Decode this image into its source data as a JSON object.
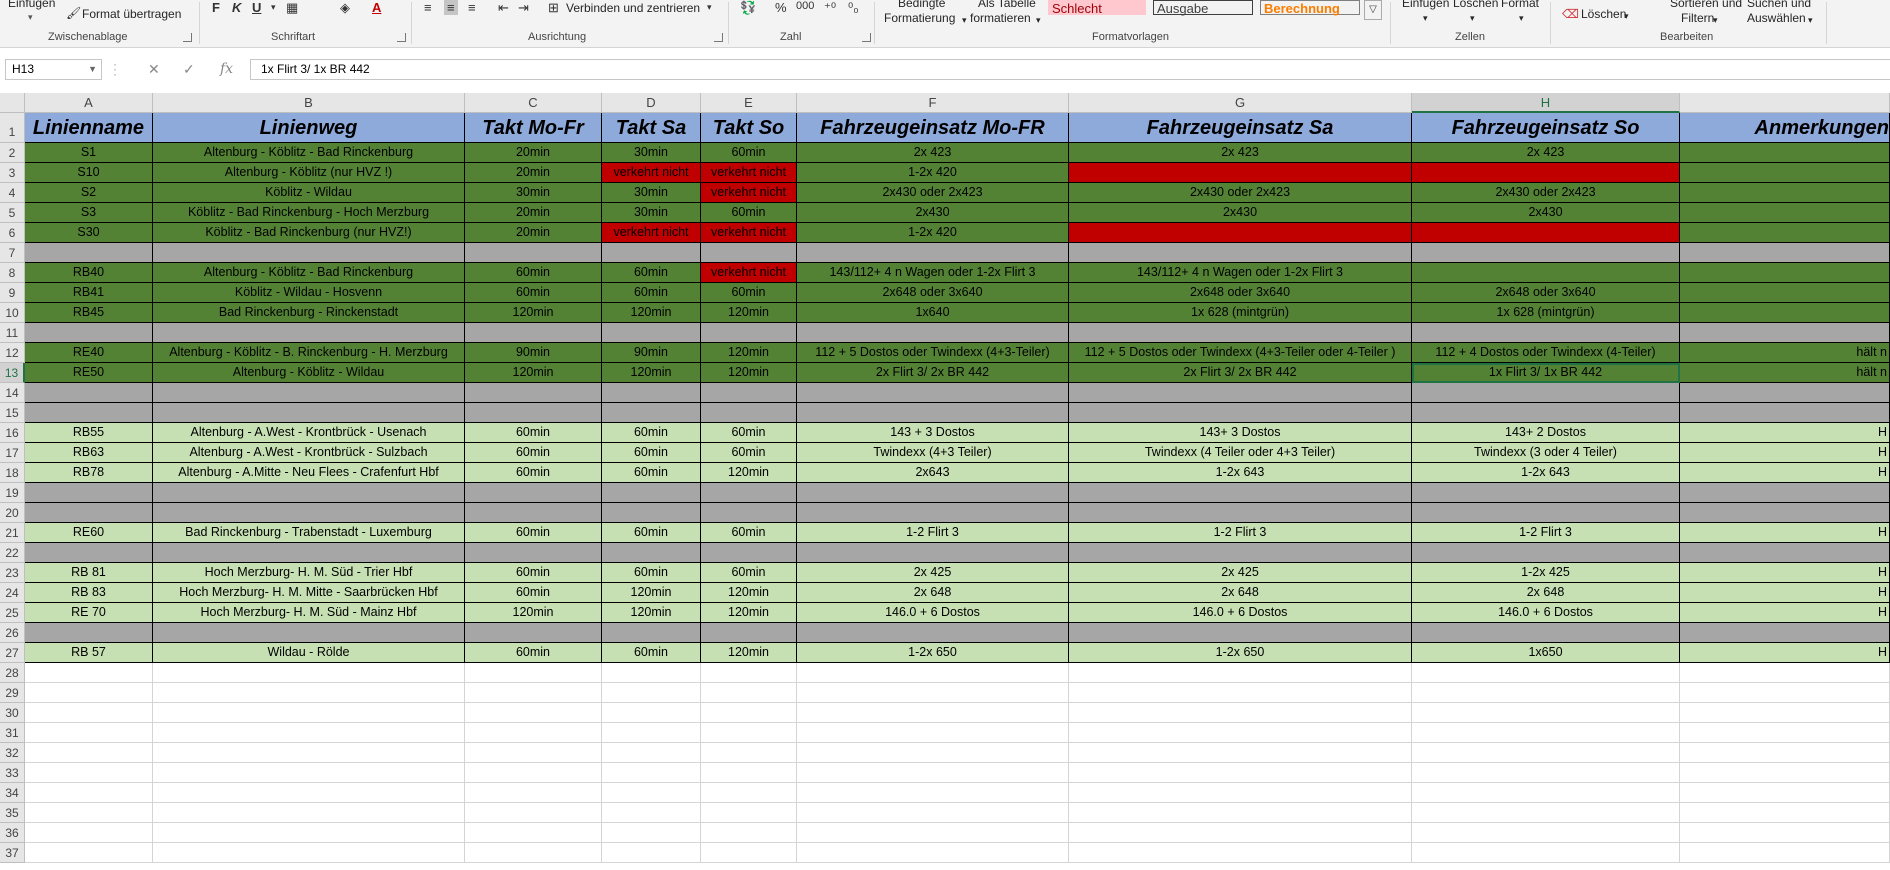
{
  "ribbon": {
    "einfuegen": "Einfügen",
    "format_uebertragen": "Format übertragen",
    "group_zwischenablage": "Zwischenablage",
    "font_buttons": [
      "F",
      "K",
      "U"
    ],
    "group_schriftart": "Schriftart",
    "verbinden": "Verbinden und zentrieren",
    "group_ausrichtung": "Ausrichtung",
    "zahl_percent": "%",
    "zahl_thousands": "000",
    "group_zahl": "Zahl",
    "bedingte_1": "Bedingte",
    "bedingte_2": "Formatierung",
    "tabelle_1": "Als Tabelle",
    "tabelle_2": "formatieren",
    "style_schlecht": "Schlecht",
    "style_ausgabe": "Ausgabe",
    "style_berechnung": "Berechnung",
    "group_formatvorlagen": "Formatvorlagen",
    "zellen_einfuegen": "Einfügen",
    "zellen_loeschen": "Löschen",
    "zellen_format": "Format",
    "group_zellen": "Zellen",
    "loeschen": "Löschen",
    "sortieren_1": "Sortieren und",
    "sortieren_2": "Filtern",
    "suchen_1": "Suchen und",
    "suchen_2": "Auswählen",
    "group_bearbeiten": "Bearbeiten"
  },
  "formula_bar": {
    "name_box": "H13",
    "formula": "1x Flirt 3/ 1x BR 442"
  },
  "columns": [
    "A",
    "B",
    "C",
    "D",
    "E",
    "F",
    "G",
    "H",
    ""
  ],
  "rows": [
    {
      "n": "1",
      "t": "hdr",
      "c": [
        "Linienname",
        "Linienweg",
        "Takt Mo-Fr",
        "Takt Sa",
        "Takt So",
        "Fahrzeugeinsatz Mo-FR",
        "Fahrzeugeinsatz Sa",
        "Fahrzeugeinsatz So",
        "Anmerkungen"
      ]
    },
    {
      "n": "2",
      "t": "dk",
      "c": [
        "S1",
        "Altenburg - Köblitz - Bad Rinckenburg",
        "20min",
        "30min",
        "60min",
        "2x 423",
        "2x 423",
        "2x 423",
        ""
      ]
    },
    {
      "n": "3",
      "t": "dk",
      "c": [
        "S10",
        "Altenburg - Köblitz (nur HVZ !)",
        "20min",
        "verkehrt nicht",
        "verkehrt nicht",
        "1-2x 420",
        "",
        "",
        ""
      ],
      "red": [
        3,
        4,
        6,
        7
      ]
    },
    {
      "n": "4",
      "t": "dk",
      "c": [
        "S2",
        "Köblitz - Wildau",
        "30min",
        "30min",
        "verkehrt nicht",
        "2x430 oder 2x423",
        "2x430 oder 2x423",
        "2x430 oder 2x423",
        ""
      ],
      "red": [
        4
      ]
    },
    {
      "n": "5",
      "t": "dk",
      "c": [
        "S3",
        "Köblitz  - Bad Rinckenburg - Hoch Merzburg",
        "20min",
        "30min",
        "60min",
        "2x430",
        "2x430",
        "2x430",
        ""
      ]
    },
    {
      "n": "6",
      "t": "dk",
      "c": [
        "S30",
        "Köblitz - Bad Rinckenburg (nur HVZ!)",
        "20min",
        "verkehrt nicht",
        "verkehrt nicht",
        "1-2x 420",
        "",
        "",
        ""
      ],
      "red": [
        3,
        4,
        6,
        7
      ]
    },
    {
      "n": "7",
      "t": "gr",
      "c": [
        "",
        "",
        "",
        "",
        "",
        "",
        "",
        "",
        ""
      ]
    },
    {
      "n": "8",
      "t": "dk",
      "c": [
        "RB40",
        "Altenburg - Köblitz - Bad Rinckenburg",
        "60min",
        "60min",
        "verkehrt nicht",
        "143/112+ 4 n Wagen oder 1-2x Flirt 3",
        "143/112+ 4 n Wagen oder 1-2x Flirt 3",
        "",
        ""
      ],
      "red": [
        4
      ]
    },
    {
      "n": "9",
      "t": "dk",
      "c": [
        "RB41",
        "Köblitz - Wildau - Hosvenn",
        "60min",
        "60min",
        "60min",
        "2x648 oder 3x640",
        "2x648 oder 3x640",
        "2x648 oder 3x640",
        ""
      ]
    },
    {
      "n": "10",
      "t": "dk",
      "c": [
        "RB45",
        "Bad Rinckenburg - Rinckenstadt",
        "120min",
        "120min",
        "120min",
        "1x640",
        "1x 628 (mintgrün)",
        "1x 628 (mintgrün)",
        ""
      ]
    },
    {
      "n": "11",
      "t": "gr",
      "c": [
        "",
        "",
        "",
        "",
        "",
        "",
        "",
        "",
        ""
      ]
    },
    {
      "n": "12",
      "t": "dk",
      "c": [
        "RE40",
        "Altenburg - Köblitz - B. Rinckenburg - H. Merzburg",
        "90min",
        "90min",
        "120min",
        "112 + 5 Dostos oder Twindexx (4+3-Teiler)",
        "112 + 5 Dostos oder Twindexx (4+3-Teiler oder 4-Teiler )",
        "112 + 4 Dostos oder Twindexx (4-Teiler)",
        "hält n"
      ]
    },
    {
      "n": "13",
      "t": "dk",
      "c": [
        "RE50",
        "Altenburg - Köblitz - Wildau",
        "120min",
        "120min",
        "120min",
        "2x Flirt 3/ 2x BR 442",
        "2x Flirt 3/ 2x BR 442",
        "1x Flirt 3/ 1x BR 442",
        "hält n"
      ]
    },
    {
      "n": "14",
      "t": "gr",
      "c": [
        "",
        "",
        "",
        "",
        "",
        "",
        "",
        "",
        ""
      ]
    },
    {
      "n": "15",
      "t": "gr",
      "c": [
        "",
        "",
        "",
        "",
        "",
        "",
        "",
        "",
        ""
      ]
    },
    {
      "n": "16",
      "t": "lt",
      "c": [
        "RB55",
        "Altenburg - A.West - Krontbrück - Usenach",
        "60min",
        "60min",
        "60min",
        "143 + 3 Dostos",
        "143+ 3 Dostos",
        "143+ 2 Dostos",
        "H"
      ]
    },
    {
      "n": "17",
      "t": "lt",
      "c": [
        "RB63",
        "Altenburg - A.West - Krontbrück - Sulzbach",
        "60min",
        "60min",
        "60min",
        "Twindexx (4+3 Teiler)",
        "Twindexx (4 Teiler oder 4+3 Teiler)",
        "Twindexx (3 oder 4 Teiler)",
        "H"
      ]
    },
    {
      "n": "18",
      "t": "lt",
      "c": [
        "RB78",
        "Altenburg - A.Mitte - Neu Flees - Crafenfurt Hbf",
        "60min",
        "60min",
        "120min",
        "2x643",
        "1-2x 643",
        "1-2x 643",
        "H"
      ]
    },
    {
      "n": "19",
      "t": "gr",
      "c": [
        "",
        "",
        "",
        "",
        "",
        "",
        "",
        "",
        ""
      ]
    },
    {
      "n": "20",
      "t": "gr",
      "c": [
        "",
        "",
        "",
        "",
        "",
        "",
        "",
        "",
        ""
      ]
    },
    {
      "n": "21",
      "t": "lt",
      "c": [
        "RE60",
        "Bad Rinckenburg - Trabenstadt - Luxemburg",
        "60min",
        "60min",
        "60min",
        "1-2 Flirt 3",
        "1-2 Flirt 3",
        "1-2 Flirt 3",
        "H"
      ]
    },
    {
      "n": "22",
      "t": "gr",
      "c": [
        "",
        "",
        "",
        "",
        "",
        "",
        "",
        "",
        ""
      ]
    },
    {
      "n": "23",
      "t": "lt",
      "c": [
        "RB 81",
        "Hoch Merzburg- H. M. Süd - Trier  Hbf",
        "60min",
        "60min",
        "60min",
        "2x 425",
        "2x 425",
        "1-2x 425",
        "H"
      ]
    },
    {
      "n": "24",
      "t": "lt",
      "c": [
        "RB 83",
        "Hoch Merzburg- H. M. Mitte - Saarbrücken  Hbf",
        "60min",
        "120min",
        "120min",
        "2x 648",
        "2x 648",
        "2x 648",
        "H"
      ]
    },
    {
      "n": "25",
      "t": "lt",
      "c": [
        "RE 70",
        "Hoch Merzburg- H. M. Süd - Mainz Hbf",
        "120min",
        "120min",
        "120min",
        "146.0 + 6 Dostos",
        "146.0 + 6 Dostos",
        "146.0 + 6 Dostos",
        "H"
      ]
    },
    {
      "n": "26",
      "t": "gr",
      "c": [
        "",
        "",
        "",
        "",
        "",
        "",
        "",
        "",
        ""
      ]
    },
    {
      "n": "27",
      "t": "lt",
      "c": [
        "RB 57",
        "Wildau - Rölde",
        "60min",
        "60min",
        "120min",
        "1-2x 650",
        "1-2x 650",
        "1x650",
        "H"
      ]
    },
    {
      "n": "28",
      "t": "wt",
      "c": [
        "",
        "",
        "",
        "",
        "",
        "",
        "",
        "",
        ""
      ]
    },
    {
      "n": "29",
      "t": "wt",
      "c": [
        "",
        "",
        "",
        "",
        "",
        "",
        "",
        "",
        ""
      ]
    },
    {
      "n": "30",
      "t": "wt",
      "c": [
        "",
        "",
        "",
        "",
        "",
        "",
        "",
        "",
        ""
      ]
    },
    {
      "n": "31",
      "t": "wt",
      "c": [
        "",
        "",
        "",
        "",
        "",
        "",
        "",
        "",
        ""
      ]
    },
    {
      "n": "32",
      "t": "wt",
      "c": [
        "",
        "",
        "",
        "",
        "",
        "",
        "",
        "",
        ""
      ]
    },
    {
      "n": "33",
      "t": "wt",
      "c": [
        "",
        "",
        "",
        "",
        "",
        "",
        "",
        "",
        ""
      ]
    },
    {
      "n": "34",
      "t": "wt",
      "c": [
        "",
        "",
        "",
        "",
        "",
        "",
        "",
        "",
        ""
      ]
    },
    {
      "n": "35",
      "t": "wt",
      "c": [
        "",
        "",
        "",
        "",
        "",
        "",
        "",
        "",
        ""
      ]
    },
    {
      "n": "36",
      "t": "wt",
      "c": [
        "",
        "",
        "",
        "",
        "",
        "",
        "",
        "",
        ""
      ]
    },
    {
      "n": "37",
      "t": "wt",
      "c": [
        "",
        "",
        "",
        "",
        "",
        "",
        "",
        "",
        ""
      ]
    }
  ],
  "selected_cell": {
    "row": "13",
    "col": "H"
  },
  "colors": {
    "header_blue": "#8eaadb",
    "dark_green": "#548235",
    "light_green": "#c6e0b4",
    "gray": "#a6a6a6",
    "red": "#c00000",
    "excel_green": "#217346"
  }
}
